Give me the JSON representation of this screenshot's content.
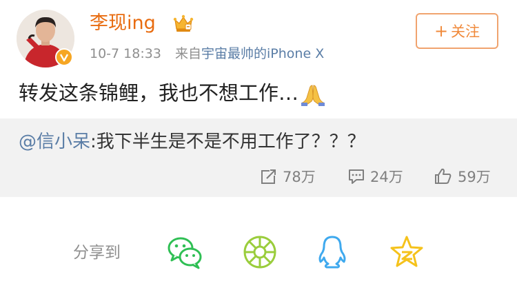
{
  "user": {
    "name": "李现ing",
    "verified": true
  },
  "meta": {
    "time": "10-7 18:33",
    "source_prefix": "来自",
    "source": "宇宙最帅的iPhone X"
  },
  "follow_button": {
    "plus": "+",
    "label": "关注"
  },
  "post": {
    "text": "转发这条锦鲤，我也不想工作…"
  },
  "repost": {
    "mention": "@信小呆",
    "text": ":我下半生是不是不用工作了？？？"
  },
  "stats": {
    "reposts": "78万",
    "comments": "24万",
    "likes": "59万"
  },
  "share": {
    "label": "分享到",
    "targets": [
      "wechat-icon",
      "moments-icon",
      "qq-icon",
      "qzone-icon"
    ]
  },
  "colors": {
    "name": "#e86b0f",
    "link": "#5a7da6",
    "follow": "#f08a3b",
    "repost_bg": "#f2f2f2",
    "wechat": "#2fbf54",
    "moments": "#9acd3c",
    "qq": "#3fa9ee",
    "qzone": "#f5c21b"
  }
}
